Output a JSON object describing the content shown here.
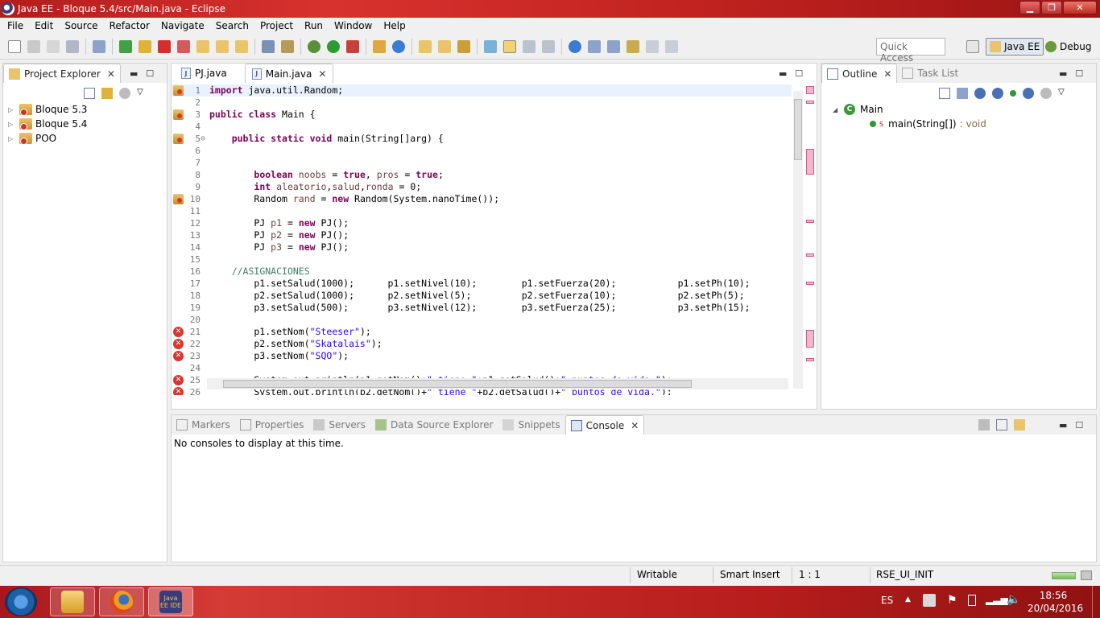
{
  "window": {
    "title": "Java EE - Bloque 5.4/src/Main.java - Eclipse"
  },
  "menu": [
    "File",
    "Edit",
    "Source",
    "Refactor",
    "Navigate",
    "Search",
    "Project",
    "Run",
    "Window",
    "Help"
  ],
  "toolbar": {
    "quick_access_placeholder": "Quick Access",
    "perspective_javaee": "Java EE",
    "perspective_debug": "Debug"
  },
  "project_explorer": {
    "tab_label": "Project Explorer",
    "projects": [
      "Bloque 5.3",
      "Bloque 5.4",
      "POO"
    ]
  },
  "editor": {
    "tabs": [
      {
        "label": "PJ.java",
        "active": false
      },
      {
        "label": "Main.java",
        "active": true
      }
    ]
  },
  "outline": {
    "tab_label": "Outline",
    "task_list_label": "Task List",
    "class_name": "Main",
    "method_name": "main(String[])",
    "method_return": ": void"
  },
  "bottom_panel": {
    "tabs": [
      "Markers",
      "Properties",
      "Servers",
      "Data Source Explorer",
      "Snippets",
      "Console"
    ],
    "active_tab": "Console",
    "message": "No consoles to display at this time."
  },
  "status": {
    "writable": "Writable",
    "insert_mode": "Smart Insert",
    "position": "1 : 1",
    "job": "RSE_UI_INIT"
  },
  "taskbar": {
    "language": "ES",
    "time": "18:56",
    "date": "20/04/2016",
    "javaee_app_label": "Java EE IDE"
  },
  "colors": {
    "keyword": "#7f0055",
    "string": "#2a00ff",
    "comment": "#3f7f5f",
    "error_marker": "#d9362f",
    "taskbar_red": "#c42a26"
  }
}
